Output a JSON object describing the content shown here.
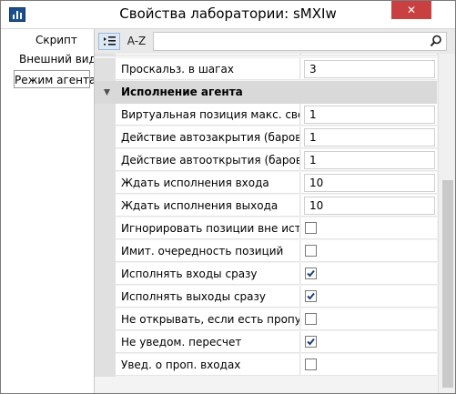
{
  "window": {
    "title": "Свойства лаборатории: sMXIw",
    "close_label": "✕"
  },
  "sidebar": {
    "items": [
      {
        "label": "Скрипт"
      },
      {
        "label": "Внешний вид"
      },
      {
        "label": "Режим агента",
        "selected": true
      }
    ]
  },
  "toolbar": {
    "sort_categorized_icon": "categorized-list-icon",
    "sort_alpha_label": "A-Z",
    "search_placeholder": "",
    "search_icon": "magnifier-icon"
  },
  "properties": {
    "top_row": {
      "label": "Проскальз. в шагах",
      "value": "3"
    },
    "category": {
      "label": "Исполнение агента",
      "expanded": true
    },
    "rows": [
      {
        "label": "Виртуальная позиция макс. свечей",
        "type": "text",
        "value": "1"
      },
      {
        "label": "Действие автозакрытия (баров)",
        "type": "text",
        "value": "1"
      },
      {
        "label": "Действие автооткрытия (баров)",
        "type": "text",
        "value": "1"
      },
      {
        "label": "Ждать исполнения входа",
        "type": "text",
        "value": "10"
      },
      {
        "label": "Ждать исполнения выхода",
        "type": "text",
        "value": "10"
      },
      {
        "label": "Игнорировать позиции вне истории",
        "type": "check",
        "checked": false
      },
      {
        "label": "Имит. очередность позиций",
        "type": "check",
        "checked": false
      },
      {
        "label": "Исполнять входы сразу",
        "type": "check",
        "checked": true
      },
      {
        "label": "Исполнять выходы сразу",
        "type": "check",
        "checked": true
      },
      {
        "label": "Не открывать, если есть пропуск в",
        "type": "check",
        "checked": false
      },
      {
        "label": "Не уведом. пересчет",
        "type": "check",
        "checked": true
      },
      {
        "label": "Увед. о проп. входах",
        "type": "check",
        "checked": false
      }
    ]
  },
  "colors": {
    "accent": "#1a4f8f",
    "category_bg": "#d9d9d9",
    "close_bg": "#c84040"
  }
}
